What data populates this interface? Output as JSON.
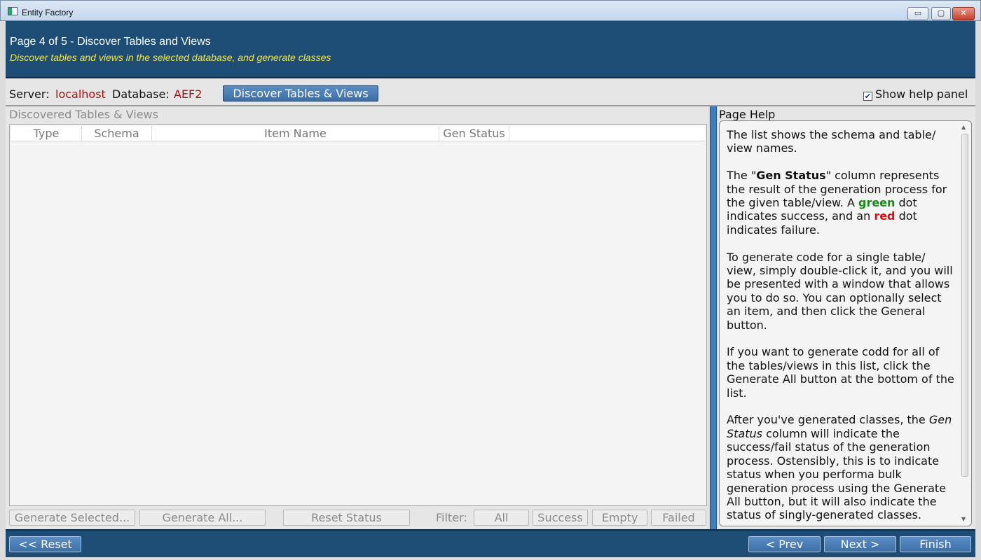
{
  "window": {
    "title": "Entity Factory",
    "controls": {
      "minimize": "▭",
      "maximize": "▢",
      "close": "✕"
    }
  },
  "header": {
    "title": "Page 4 of 5 - Discover Tables and Views",
    "subtitle": "Discover tables and views in the selected database, and generate classes"
  },
  "server_bar": {
    "server_label": "Server:",
    "server_value": "localhost",
    "database_label": "Database:",
    "database_value": "AEF2",
    "discover_button": "Discover Tables & Views",
    "help_toggle_label": "Show help panel",
    "help_toggle_checked": true,
    "checkmark": "✔"
  },
  "discovered": {
    "section_label": "Discovered Tables & Views",
    "columns": [
      "Type",
      "Schema",
      "Item Name",
      "Gen Status"
    ],
    "rows": []
  },
  "actions": {
    "generate_selected": "Generate Selected...",
    "generate_all": "Generate All...",
    "reset_status": "Reset Status",
    "filter_label": "Filter:",
    "filters": [
      "All",
      "Success",
      "Empty",
      "Failed"
    ]
  },
  "help": {
    "title": "Page Help",
    "p1": "The list shows the schema and table/ view names.",
    "p2_a": "The \"",
    "p2_bold": "Gen Status",
    "p2_b": "\" column represents the result of the generation process for the given table/view. A ",
    "p2_green": "green",
    "p2_c": " dot indicates success, and an ",
    "p2_red": "red",
    "p2_d": " dot indicates failure.",
    "p3": "To generate code for a single table/ view, simply double-click it, and you will be presented with a window that allows you to do so. You can optionally select an item, and then click the General button.",
    "p4": "If you want to generate codd for all of the tables/views in this list, click the Generate All button at the bottom of the list.",
    "p5_a": "After you've generated classes, the ",
    "p5_italic": "Gen Status",
    "p5_b": " column will indicate the success/fail status of the generation process. Ostensibly, this is to indicate status when you performa bulk generation process using the Generate All button, but it will also indicate the status of singly-generated classes."
  },
  "footer": {
    "reset": "<< Reset",
    "prev": "< Prev",
    "next": "Next >",
    "finish": "Finish"
  },
  "colors": {
    "header_bg": "#1d4c74",
    "subtitle": "#f0e84a",
    "value_red": "#a01010",
    "button_blue": "#3c6ea8",
    "splitter": "#3f7cc0"
  }
}
